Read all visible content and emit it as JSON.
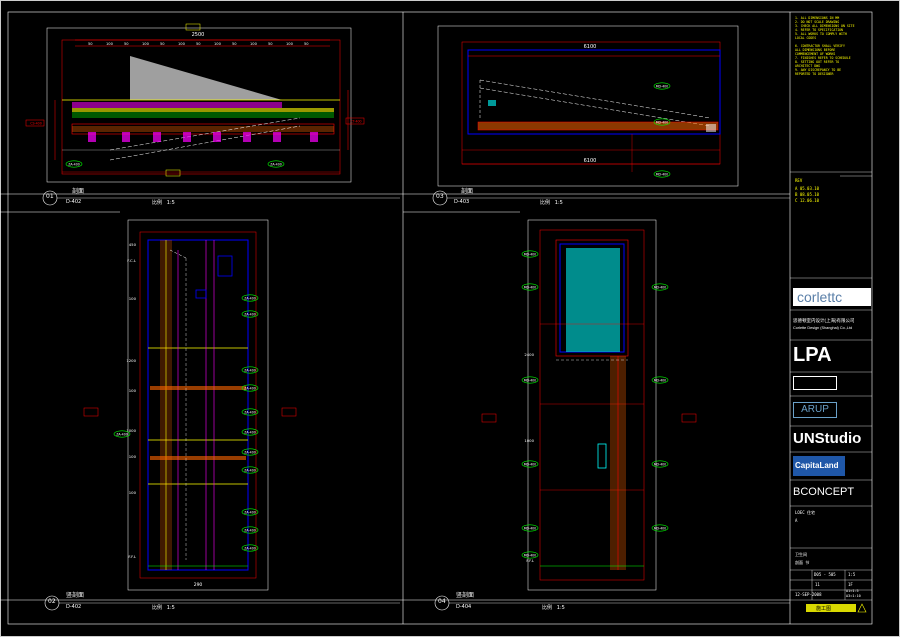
{
  "views": [
    {
      "number": "01",
      "title": "剖面",
      "ref": "D-402",
      "scale_label": "比例",
      "scale": "1:5"
    },
    {
      "number": "03",
      "title": "剖面",
      "ref": "D-403",
      "scale_label": "比例",
      "scale": "1:5"
    },
    {
      "number": "02",
      "title": "竖剖面",
      "ref": "D-402",
      "scale_label": "比例",
      "scale": "1:5"
    },
    {
      "number": "04",
      "title": "竖剖面",
      "ref": "D-404",
      "scale_label": "比例",
      "scale": "1:5"
    }
  ],
  "dims": {
    "v01_top": "2500",
    "v01_segs": [
      "50",
      "100",
      "50",
      "100",
      "50",
      "100",
      "50",
      "100",
      "50",
      "100",
      "50",
      "100",
      "50"
    ],
    "v03_top": "6100",
    "v03_bottom": "6100",
    "v02_left": [
      "450",
      "F.C.L",
      "100",
      "1200",
      "100",
      "1000",
      "100",
      "100",
      "F.F.L"
    ],
    "v02_bottom": "290",
    "v04_left": [
      "2400",
      "1000",
      "F.F.L"
    ]
  },
  "tags": {
    "v01": [
      "ZA-400",
      "ZA-400",
      "CS-400",
      "CT-400"
    ],
    "v03": [
      "MD-400",
      "MD-400",
      "MD-400"
    ],
    "v02": [
      "ZA-400",
      "ZA-400",
      "ZA-400",
      "ZA-400",
      "ZA-400",
      "ZA-400",
      "ZA-400",
      "ZA-400",
      "ZA-400",
      "ZA-400",
      "ZA-400",
      "ZA-400"
    ],
    "v04": [
      "MD-400",
      "MD-400",
      "MD-400",
      "MD-400",
      "MD-400",
      "MD-400",
      "MD-400",
      "MD-400",
      "MD-400",
      "MD-400"
    ]
  },
  "title_block": {
    "notes": [
      "1. ALL DIMENSIONS IN MM",
      "2. DO NOT SCALE DRAWING",
      "3. CHECK ALL DIMENSIONS ON SITE",
      "4. REFER TO SPECIFICATION",
      "5. ALL WORKS TO COMPLY WITH",
      "   LOCAL CODES",
      "",
      "6. CONTRACTOR SHALL VERIFY",
      "   ALL DIMENSIONS BEFORE",
      "   COMMENCEMENT OF WORKS",
      "7. FINISHES REFER TO SCHEDULE",
      "8. SETTING OUT REFER TO",
      "   ARCHITECT DWG",
      "9. ANY DISCREPANCY TO BE",
      "   REPORTED TO DESIGNER"
    ],
    "revision_label": "REV",
    "revisions": [
      "A  05.03.10",
      "B  08.05.10",
      "C  12.06.10"
    ],
    "logos": [
      "corlettc",
      "思德顿室内设计(上海)有限公司",
      "LPA",
      "",
      "ARUP",
      "UNStudio",
      "CapitaLand",
      "BCONCEPT"
    ],
    "logo_subtitle": "Corlette Design (Shanghai) Co.,Ltd",
    "project": "LOEC 住宅",
    "project_sub": "A",
    "drawing_title": "卫生间",
    "drawing_sub": "剖面 节",
    "drawing_no": "D05 - 505",
    "scale_cells": [
      "1:5",
      "A1=1:5",
      "A3=1:10"
    ],
    "date": "12-SEP-2008",
    "rev_cells": [
      "11",
      "1F"
    ],
    "stamp": "施工图"
  }
}
